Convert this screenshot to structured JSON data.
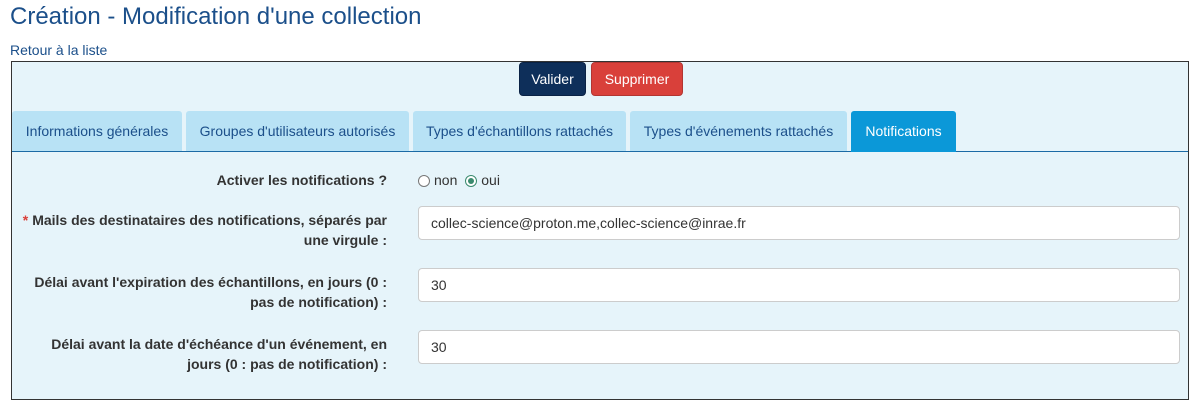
{
  "page": {
    "title": "Création - Modification d'une collection",
    "back_link": "Retour à la liste"
  },
  "actions": {
    "validate_label": "Valider",
    "delete_label": "Supprimer"
  },
  "tabs": [
    {
      "label": "Informations générales",
      "active": false
    },
    {
      "label": "Groupes d'utilisateurs autorisés",
      "active": false
    },
    {
      "label": "Types d'échantillons rattachés",
      "active": false
    },
    {
      "label": "Types d'événements rattachés",
      "active": false
    },
    {
      "label": "Notifications",
      "active": true
    }
  ],
  "form": {
    "activate": {
      "label": "Activer les notifications ?",
      "option_no": "non",
      "option_yes": "oui",
      "selected": "oui"
    },
    "mails": {
      "required_mark": "*",
      "label_line1": "Mails des destinataires des notifications, séparés par",
      "label_line2": "une virgule :",
      "value": "collec-science@proton.me,collec-science@inrae.fr"
    },
    "expiry_delay": {
      "label_line1": "Délai avant l'expiration des échantillons, en jours (0 :",
      "label_line2": "pas de notification) :",
      "value": "30"
    },
    "event_delay": {
      "label_line1": "Délai avant la date d'échéance d'un événement, en",
      "label_line2": "jours (0 : pas de notification) :",
      "value": "30"
    }
  },
  "colors": {
    "title": "#1b4f8a",
    "panel_bg": "#e6f4fa",
    "tab_bg": "#b8e2f5",
    "tab_active_bg": "#0b98d8",
    "validate_bg": "#0e2f5a",
    "delete_bg": "#d9403a"
  }
}
